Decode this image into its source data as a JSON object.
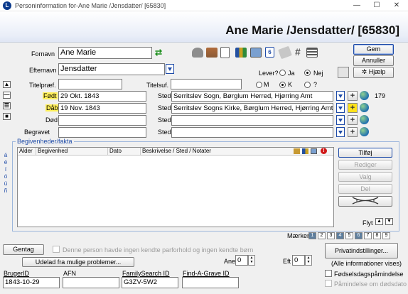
{
  "window": {
    "app_icon": "L",
    "title": "Personinformation for-Ane Marie /Jensdatter/ [65830]",
    "minimize": "—",
    "maximize": "☐",
    "close": "✕"
  },
  "header": {
    "title": "Ane Marie /Jensdatter/ [65830]"
  },
  "toolbar_icons": [
    "people-icon",
    "house-icon",
    "document-icon",
    "books-icon",
    "photo-icon",
    "calendar-icon",
    "stamp-icon",
    "hash-icon",
    "list-icon"
  ],
  "calendar_day": "6",
  "form": {
    "fornavn_label": "Fornavn",
    "fornavn_value": "Ane Marie",
    "swap_glyph": "⇄",
    "efternavn_label": "Efternavn",
    "efternavn_value": "Jensdatter",
    "titelpraef_label": "Titelpræf.",
    "titelsuf_label": "Titelsuf.",
    "lever_label": "Lever?",
    "lever_ja": "Ja",
    "lever_nej": "Nej",
    "sex_m": "M",
    "sex_k": "K",
    "sex_unknown": "?"
  },
  "buttons": {
    "gem": "Gem",
    "annuller": "Annuller",
    "hjaelp": "Hjælp",
    "hjaelp_icon": "✲"
  },
  "events": [
    {
      "label": "Født",
      "date": "29 Okt. 1843",
      "sted": "Sted",
      "place": "Serritslev Sogn, Børglum Herred, Hjørring Amt",
      "count": "179",
      "highlight": true
    },
    {
      "label": "Dåb",
      "date": "19 Nov. 1843",
      "sted": "Sted",
      "place": "Serritslev Sogns Kirke, Børglum Herred, Hjørring Amt",
      "count": "",
      "highlight": true
    },
    {
      "label": "Død",
      "date": "",
      "sted": "Sted",
      "place": "",
      "count": "",
      "highlight": false
    },
    {
      "label": "Begravet",
      "date": "",
      "sted": "Sted",
      "place": "",
      "count": "",
      "highlight": false
    }
  ],
  "side_nav": [
    "▲",
    "—",
    "☰",
    "■"
  ],
  "side_letters": [
    "á",
    "é",
    "í",
    "ó",
    "ú",
    "ñ"
  ],
  "begivenheder": {
    "legend": "Begivenheder/fakta",
    "columns": [
      "Alder",
      "Begivenhed",
      "Dato",
      "Beskrivelse / Sted / Notater"
    ],
    "buttons": {
      "tilfoej": "Tilføj",
      "rediger": "Rediger",
      "valg": "Valg",
      "del": "Del"
    },
    "flyt_label": "Flyt"
  },
  "maerker": {
    "label": "Mærker",
    "numbers": [
      "1",
      "2",
      "3",
      "4",
      "5",
      "6",
      "7",
      "8",
      "9"
    ],
    "active": [
      "1",
      "4",
      "6"
    ]
  },
  "gentag": "Gentag",
  "no_parents_text": "Denne person havde ingen kendte parforhold og ingen kendte børn",
  "udelad": "Udelad fra mulige problemer...",
  "ane_label": "Ane",
  "ane_value": "0",
  "eft_label": "Eft",
  "eft_value": "0",
  "privat_btn": "Privatindstillinger...",
  "alle_info": "(Alle informationer vises)",
  "ids": {
    "brugerid_label": "BrugerID",
    "brugerid_value": "1843-10-29",
    "afn_label": "AFN",
    "afn_value": "",
    "familysearch_label": "FamilySearch ID",
    "familysearch_value": "G3ZV-5W2",
    "findagrave_label": "Find-A-Grave ID",
    "findagrave_value": ""
  },
  "checks": {
    "birthday": "Fødselsdagspåmindelse",
    "deathday": "Påmindelse om dødsdato"
  }
}
